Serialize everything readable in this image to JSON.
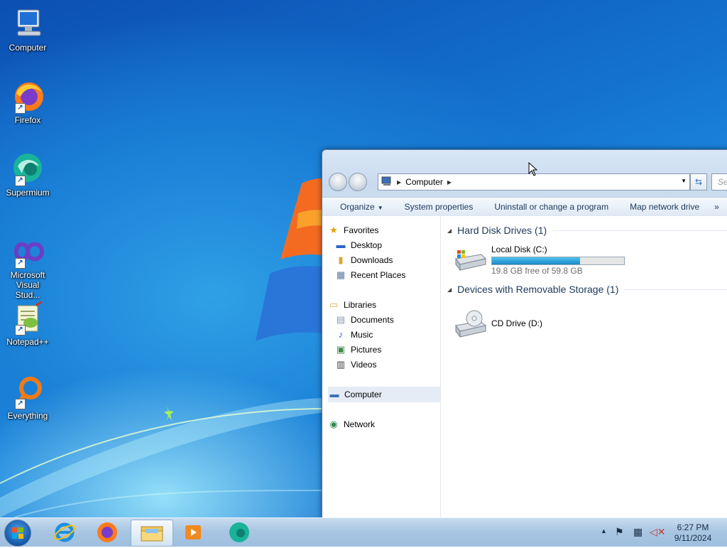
{
  "desktop": {
    "icons": [
      {
        "label": "Computer",
        "icon": "computer-icon"
      },
      {
        "label": "Firefox",
        "icon": "firefox-icon"
      },
      {
        "label": "Supermium",
        "icon": "supermium-icon"
      },
      {
        "label": "Microsoft Visual Stud...",
        "icon": "visual-studio-icon"
      },
      {
        "label": "Notepad++",
        "icon": "notepad-plus-plus-icon"
      },
      {
        "label": "Everything",
        "icon": "everything-icon"
      }
    ]
  },
  "explorer": {
    "address": {
      "crumb": "Computer"
    },
    "search": {
      "placeholder": "Se"
    },
    "toolbar": {
      "organize": "Organize",
      "system_properties": "System properties",
      "uninstall": "Uninstall or change a program",
      "map_network": "Map network drive",
      "more": "»"
    },
    "nav": {
      "favorites": "Favorites",
      "desktop": "Desktop",
      "downloads": "Downloads",
      "recent_places": "Recent Places",
      "libraries": "Libraries",
      "documents": "Documents",
      "music": "Music",
      "pictures": "Pictures",
      "videos": "Videos",
      "computer": "Computer",
      "network": "Network"
    },
    "groups": {
      "hard_disks": "Hard Disk Drives (1)",
      "removable": "Devices with Removable Storage (1)"
    },
    "drives": {
      "c": {
        "name": "Local Disk (C:)",
        "free": "19.8 GB free of 59.8 GB",
        "used_fraction": 0.669
      },
      "d": {
        "name": "CD Drive (D:)"
      }
    }
  },
  "taskbar": {
    "time": "6:27 PM",
    "date": "9/11/2024"
  }
}
